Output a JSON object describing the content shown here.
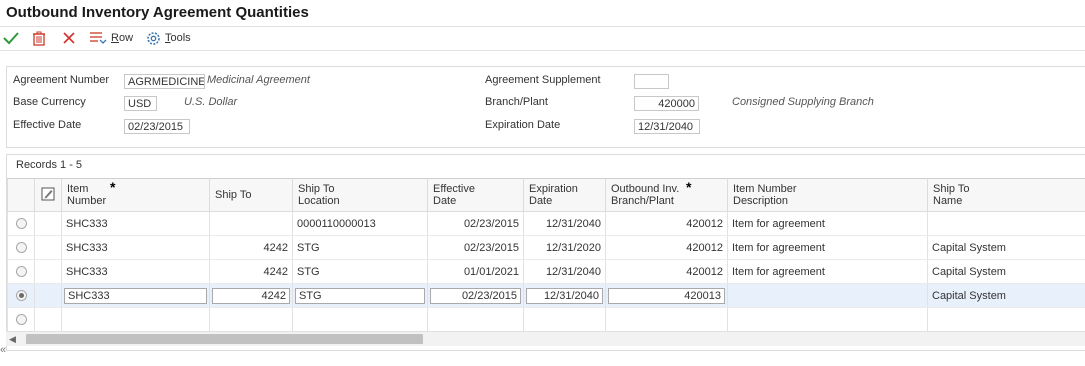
{
  "window": {
    "title": "Outbound Inventory Agreement Quantities"
  },
  "toolbar": {
    "ok_icon": "check-icon",
    "delete_icon": "trash-icon",
    "cancel_icon": "close-icon",
    "row_label_prefix": "R",
    "row_label_rest": "ow",
    "tools_label_prefix": "T",
    "tools_label_rest": "ools",
    "colors": {
      "ok": "#2e9a3a",
      "cancel": "#d0312d",
      "delete": "#cc3a2a",
      "accent": "#3a76b0"
    }
  },
  "header": {
    "agreement_number_label": "Agreement Number",
    "agreement_number_value": "AGRMEDICINE",
    "agreement_description": "Medicinal Agreement",
    "base_currency_label": "Base Currency",
    "base_currency_value": "USD",
    "base_currency_description": "U.S. Dollar",
    "effective_date_label": "Effective Date",
    "effective_date_value": "02/23/2015",
    "agreement_supplement_label": "Agreement Supplement",
    "agreement_supplement_value": "",
    "branch_plant_label": "Branch/Plant",
    "branch_plant_value": "420000",
    "branch_plant_description": "Consigned Supplying Branch",
    "expiration_date_label": "Expiration Date",
    "expiration_date_value": "12/31/2040"
  },
  "grid": {
    "records_label": "Records 1 - 5",
    "columns": {
      "item_number_1": "Item",
      "item_number_2": "Number",
      "ship_to": "Ship To",
      "ship_to_location_1": "Ship To",
      "ship_to_location_2": "Location",
      "effective_date_1": "Effective",
      "effective_date_2": "Date",
      "expiration_date_1": "Expiration",
      "expiration_date_2": "Date",
      "outbound_1": "Outbound Inv.",
      "outbound_2": "Branch/Plant",
      "item_desc_1": "Item Number",
      "item_desc_2": "Description",
      "ship_to_name_1": "Ship To",
      "ship_to_name_2": "Name",
      "required_marker": "*"
    },
    "rows": [
      {
        "item": "SHC333",
        "ship_to": "",
        "location": "0000110000013",
        "effective": "02/23/2015",
        "expiration": "12/31/2040",
        "branch": "420012",
        "description": "Item for agreement",
        "ship_to_name": ""
      },
      {
        "item": "SHC333",
        "ship_to": "4242",
        "location": "STG",
        "effective": "02/23/2015",
        "expiration": "12/31/2020",
        "branch": "420012",
        "description": "Item for agreement",
        "ship_to_name": "Capital System"
      },
      {
        "item": "SHC333",
        "ship_to": "4242",
        "location": "STG",
        "effective": "01/01/2021",
        "expiration": "12/31/2040",
        "branch": "420012",
        "description": "Item for agreement",
        "ship_to_name": "Capital System"
      },
      {
        "item": "SHC333",
        "ship_to": "4242",
        "location": "STG",
        "effective": "02/23/2015",
        "expiration": "12/31/2040",
        "branch": "420013",
        "description": "",
        "ship_to_name": "Capital System"
      }
    ],
    "selected_row": 3
  }
}
